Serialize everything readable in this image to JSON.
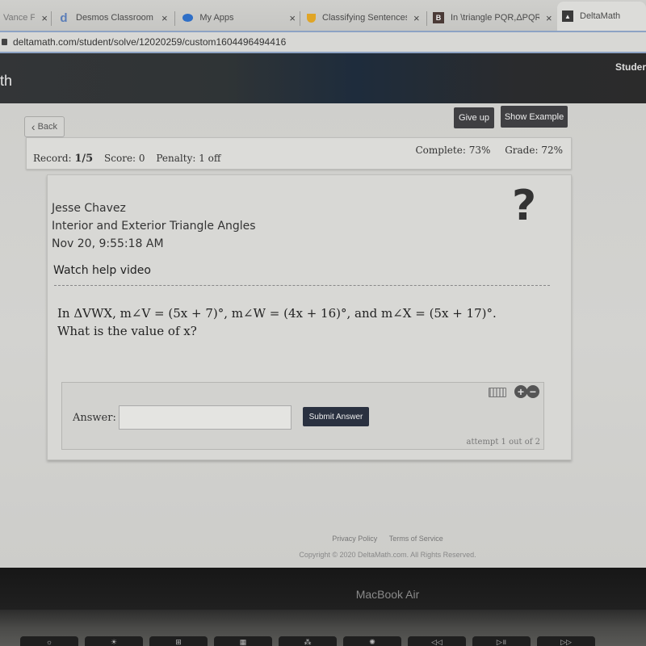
{
  "browser": {
    "tabs": [
      {
        "title": "Vance F",
        "icon": "generic-favicon",
        "closable": true
      },
      {
        "title": "Desmos Classroom Ac",
        "icon": "desmos-d-icon",
        "closable": true
      },
      {
        "title": "My Apps",
        "icon": "cloud-icon",
        "closable": true
      },
      {
        "title": "Classifying Sentences",
        "icon": "shield-icon",
        "closable": true
      },
      {
        "title": "In \\triangle PQR,ΔPQR",
        "icon": "bookmark-b-icon",
        "closable": true
      },
      {
        "title": "DeltaMath",
        "icon": "deltamath-icon",
        "closable": false,
        "active": true
      }
    ],
    "close_glyph": "×",
    "url": "deltamath.com/student/solve/12020259/custom1604496494416"
  },
  "header": {
    "brand_fragment": "th",
    "student_link": "Studer"
  },
  "toolbar": {
    "back_label": "Back",
    "back_glyph": "‹",
    "give_up_label": "Give up",
    "show_example_label": "Show Example"
  },
  "record": {
    "record_label": "Record:",
    "record_value": "1/5",
    "score_label": "Score:",
    "score_value": "0",
    "penalty_label": "Penalty:",
    "penalty_value": "1 off",
    "complete_label": "Complete:",
    "complete_value": "73%",
    "grade_label": "Grade:",
    "grade_value": "72%"
  },
  "problem": {
    "student_name": "Jesse Chavez",
    "assignment_title": "Interior and Exterior Triangle Angles",
    "timestamp": "Nov 20, 9:55:18 AM",
    "help_link": "Watch help video",
    "question_mark": "?",
    "question_line1": "In ΔVWX, m∠V = (5x + 7)°, m∠W = (4x + 16)°, and m∠X = (5x + 17)°.",
    "question_line2": "What is the value of x?"
  },
  "answer": {
    "label": "Answer:",
    "value": "",
    "placeholder": "",
    "submit_label": "Submit Answer",
    "plus_glyph": "+",
    "minus_glyph": "−",
    "attempt_text": "attempt 1 out of 2"
  },
  "footer": {
    "privacy": "Privacy Policy",
    "terms": "Terms of Service",
    "copyright": "Copyright © 2020 DeltaMath.com. All Rights Reserved."
  },
  "device": {
    "label": "MacBook Air",
    "keys": [
      "☼",
      "☀",
      "⊞",
      "▦",
      "⁂",
      "✺",
      "◁◁",
      "▷॥",
      "▷▷"
    ]
  }
}
